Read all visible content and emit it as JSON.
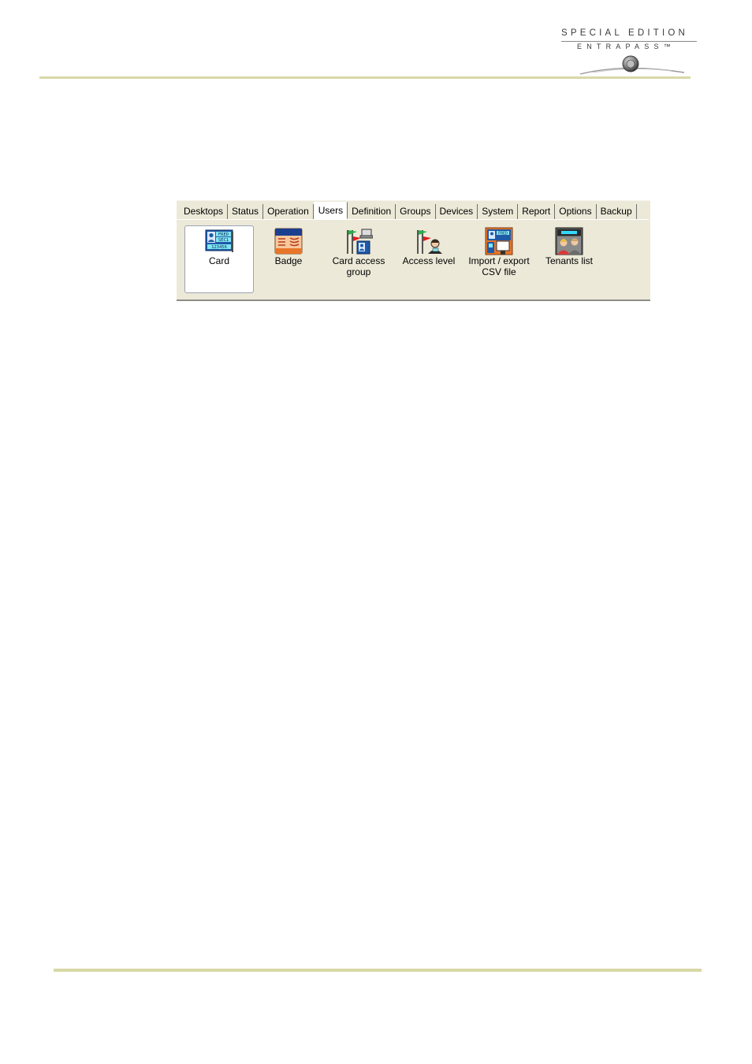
{
  "logo": {
    "line1": "SPECIAL EDITION",
    "line2": "ENTRAPASS™"
  },
  "tabs": [
    {
      "label": "Desktops",
      "active": false
    },
    {
      "label": "Status",
      "active": false
    },
    {
      "label": "Operation",
      "active": false
    },
    {
      "label": "Users",
      "active": true
    },
    {
      "label": "Definition",
      "active": false
    },
    {
      "label": "Groups",
      "active": false
    },
    {
      "label": "Devices",
      "active": false
    },
    {
      "label": "System",
      "active": false
    },
    {
      "label": "Report",
      "active": false
    },
    {
      "label": "Options",
      "active": false
    },
    {
      "label": "Backup",
      "active": false
    }
  ],
  "tools": {
    "card": {
      "label": "Card",
      "icon": "card-icon",
      "selected": true
    },
    "badge": {
      "label": "Badge",
      "icon": "badge-icon"
    },
    "card_access_group": {
      "label_line1": "Card access",
      "label_line2": "group",
      "icon": "card-access-group-icon"
    },
    "access_level": {
      "label": "Access level",
      "icon": "access-level-icon"
    },
    "import_export": {
      "label_line1": "Import / export",
      "label_line2": "CSV file",
      "icon": "import-export-csv-icon"
    },
    "tenants_list": {
      "label": "Tenants list",
      "icon": "tenants-list-icon"
    }
  },
  "icon_text": {
    "card_top": "FRED",
    "card_mid": "SEC1",
    "card_num": "123456",
    "csv_top": "FRED"
  },
  "colors": {
    "panel_bg": "#ece9d8",
    "rule": "#d8d8a6",
    "card_blue": "#1e5aa8",
    "card_cyan": "#7fe6f2"
  }
}
